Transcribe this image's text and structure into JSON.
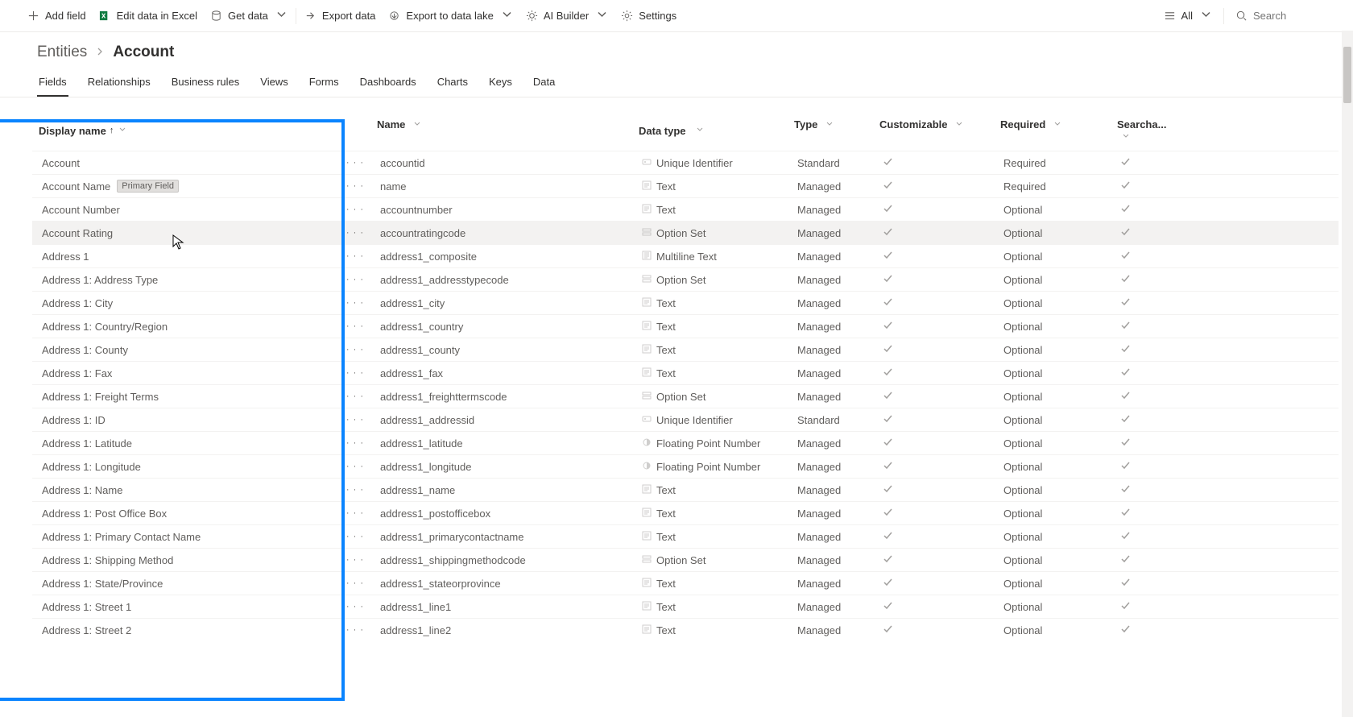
{
  "commandbar": {
    "addField": "Add field",
    "editExcel": "Edit data in Excel",
    "getData": "Get data",
    "exportData": "Export data",
    "exportLake": "Export to data lake",
    "aiBuilder": "AI Builder",
    "settings": "Settings",
    "viewAll": "All",
    "searchPlaceholder": "Search"
  },
  "breadcrumb": {
    "root": "Entities",
    "leaf": "Account"
  },
  "tabs": [
    "Fields",
    "Relationships",
    "Business rules",
    "Views",
    "Forms",
    "Dashboards",
    "Charts",
    "Keys",
    "Data"
  ],
  "activeTab": "Fields",
  "headers": {
    "display": "Display name",
    "name": "Name",
    "dtype": "Data type",
    "type": "Type",
    "cust": "Customizable",
    "req": "Required",
    "search": "Searcha..."
  },
  "primaryLabel": "Primary Field",
  "rows": [
    {
      "display": "Account",
      "name": "accountid",
      "dtype": "Unique Identifier",
      "dicon": "uid",
      "type": "Standard",
      "cust": true,
      "req": "Required",
      "search": true
    },
    {
      "display": "Account Name",
      "primary": true,
      "name": "name",
      "dtype": "Text",
      "dicon": "text",
      "type": "Managed",
      "cust": true,
      "req": "Required",
      "search": true
    },
    {
      "display": "Account Number",
      "name": "accountnumber",
      "dtype": "Text",
      "dicon": "text",
      "type": "Managed",
      "cust": true,
      "req": "Optional",
      "search": true
    },
    {
      "display": "Account Rating",
      "name": "accountratingcode",
      "dtype": "Option Set",
      "dicon": "opt",
      "type": "Managed",
      "cust": true,
      "req": "Optional",
      "search": true,
      "hovered": true
    },
    {
      "display": "Address 1",
      "name": "address1_composite",
      "dtype": "Multiline Text",
      "dicon": "mtext",
      "type": "Managed",
      "cust": true,
      "req": "Optional",
      "search": true
    },
    {
      "display": "Address 1: Address Type",
      "name": "address1_addresstypecode",
      "dtype": "Option Set",
      "dicon": "opt",
      "type": "Managed",
      "cust": true,
      "req": "Optional",
      "search": true
    },
    {
      "display": "Address 1: City",
      "name": "address1_city",
      "dtype": "Text",
      "dicon": "text",
      "type": "Managed",
      "cust": true,
      "req": "Optional",
      "search": true
    },
    {
      "display": "Address 1: Country/Region",
      "name": "address1_country",
      "dtype": "Text",
      "dicon": "text",
      "type": "Managed",
      "cust": true,
      "req": "Optional",
      "search": true
    },
    {
      "display": "Address 1: County",
      "name": "address1_county",
      "dtype": "Text",
      "dicon": "text",
      "type": "Managed",
      "cust": true,
      "req": "Optional",
      "search": true
    },
    {
      "display": "Address 1: Fax",
      "name": "address1_fax",
      "dtype": "Text",
      "dicon": "text",
      "type": "Managed",
      "cust": true,
      "req": "Optional",
      "search": true
    },
    {
      "display": "Address 1: Freight Terms",
      "name": "address1_freighttermscode",
      "dtype": "Option Set",
      "dicon": "opt",
      "type": "Managed",
      "cust": true,
      "req": "Optional",
      "search": true
    },
    {
      "display": "Address 1: ID",
      "name": "address1_addressid",
      "dtype": "Unique Identifier",
      "dicon": "uid",
      "type": "Standard",
      "cust": true,
      "req": "Optional",
      "search": true
    },
    {
      "display": "Address 1: Latitude",
      "name": "address1_latitude",
      "dtype": "Floating Point Number",
      "dicon": "float",
      "type": "Managed",
      "cust": true,
      "req": "Optional",
      "search": true
    },
    {
      "display": "Address 1: Longitude",
      "name": "address1_longitude",
      "dtype": "Floating Point Number",
      "dicon": "float",
      "type": "Managed",
      "cust": true,
      "req": "Optional",
      "search": true
    },
    {
      "display": "Address 1: Name",
      "name": "address1_name",
      "dtype": "Text",
      "dicon": "text",
      "type": "Managed",
      "cust": true,
      "req": "Optional",
      "search": true
    },
    {
      "display": "Address 1: Post Office Box",
      "name": "address1_postofficebox",
      "dtype": "Text",
      "dicon": "text",
      "type": "Managed",
      "cust": true,
      "req": "Optional",
      "search": true
    },
    {
      "display": "Address 1: Primary Contact Name",
      "name": "address1_primarycontactname",
      "dtype": "Text",
      "dicon": "text",
      "type": "Managed",
      "cust": true,
      "req": "Optional",
      "search": true
    },
    {
      "display": "Address 1: Shipping Method",
      "name": "address1_shippingmethodcode",
      "dtype": "Option Set",
      "dicon": "opt",
      "type": "Managed",
      "cust": true,
      "req": "Optional",
      "search": true
    },
    {
      "display": "Address 1: State/Province",
      "name": "address1_stateorprovince",
      "dtype": "Text",
      "dicon": "text",
      "type": "Managed",
      "cust": true,
      "req": "Optional",
      "search": true
    },
    {
      "display": "Address 1: Street 1",
      "name": "address1_line1",
      "dtype": "Text",
      "dicon": "text",
      "type": "Managed",
      "cust": true,
      "req": "Optional",
      "search": true
    },
    {
      "display": "Address 1: Street 2",
      "name": "address1_line2",
      "dtype": "Text",
      "dicon": "text",
      "type": "Managed",
      "cust": true,
      "req": "Optional",
      "search": true
    }
  ]
}
